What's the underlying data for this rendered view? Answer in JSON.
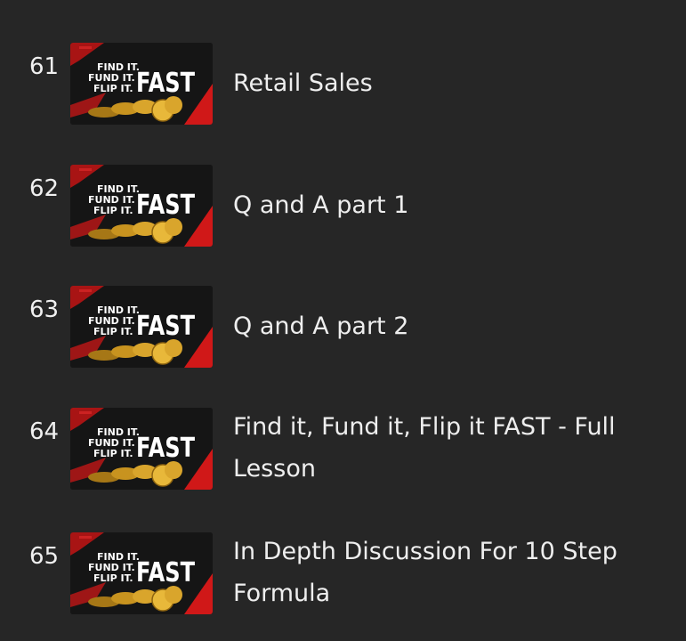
{
  "playlist": {
    "items": [
      {
        "index": "61",
        "title": "Retail Sales",
        "thumbnail": {
          "logo_text": [
            "FIND IT.",
            "FUND IT.",
            "FLIP IT.",
            "FAST"
          ]
        }
      },
      {
        "index": "62",
        "title": "Q and A part 1",
        "thumbnail": {
          "logo_text": [
            "FIND IT.",
            "FUND IT.",
            "FLIP IT.",
            "FAST"
          ]
        }
      },
      {
        "index": "63",
        "title": "Q and A part 2",
        "thumbnail": {
          "logo_text": [
            "FIND IT.",
            "FUND IT.",
            "FLIP IT.",
            "FAST"
          ]
        }
      },
      {
        "index": "64",
        "title": "Find it, Fund it, Flip it FAST - Full Lesson",
        "thumbnail": {
          "logo_text": [
            "FIND IT.",
            "FUND IT.",
            "FLIP IT.",
            "FAST"
          ]
        }
      },
      {
        "index": "65",
        "title": "In Depth Discussion For 10 Step Formula",
        "thumbnail": {
          "logo_text": [
            "FIND IT.",
            "FUND IT.",
            "FLIP IT.",
            "FAST"
          ]
        }
      }
    ]
  },
  "colors": {
    "background": "#262626",
    "thumbnail_red": "#d01818",
    "coin_gold": "#d9a52c"
  }
}
